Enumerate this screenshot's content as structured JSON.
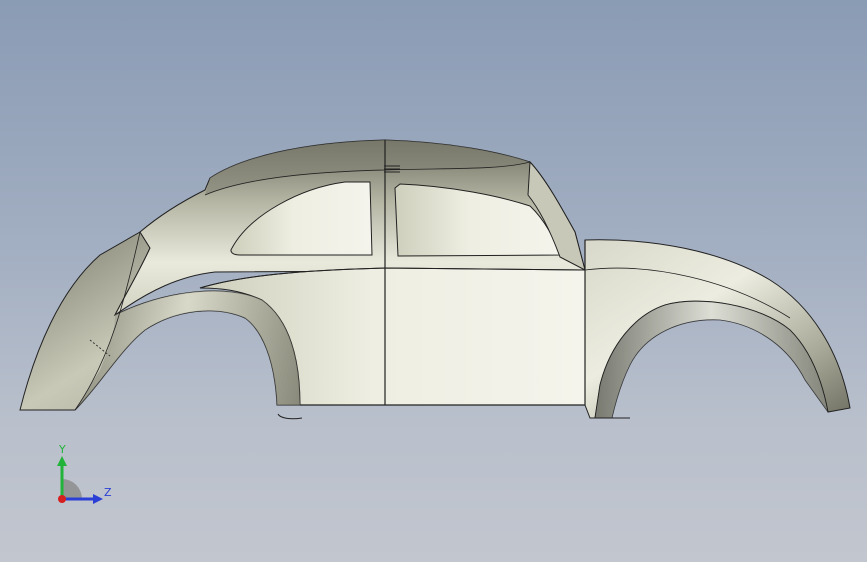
{
  "viewport": {
    "background_top": "#8a9bb4",
    "background_bottom": "#c2c6ce"
  },
  "model": {
    "body_color": "#e7e7d9",
    "edge_color": "#222222"
  },
  "triad": {
    "x_color": "#d61f1f",
    "y_color": "#22b33a",
    "z_color": "#2b3fd6",
    "y_label": "Y",
    "z_label": "Z"
  }
}
